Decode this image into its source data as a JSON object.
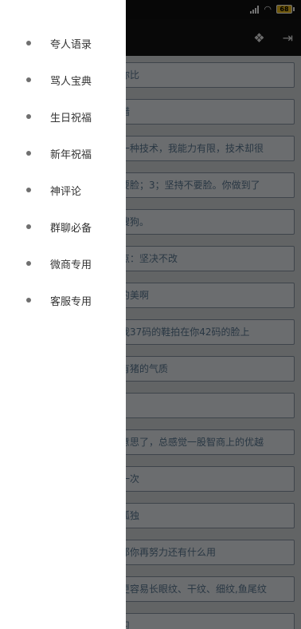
{
  "status_bar": {
    "battery_level": "68",
    "signal_icon": "signal-icon",
    "wifi_icon": "wifi-icon"
  },
  "app_bar": {
    "icons": [
      "dropbox-icon",
      "logout-icon"
    ]
  },
  "drawer": {
    "items": [
      {
        "label": "夸人语录"
      },
      {
        "label": "骂人宝典"
      },
      {
        "label": "生日祝福"
      },
      {
        "label": "新年祝福"
      },
      {
        "label": "神评论"
      },
      {
        "label": "群聊必备"
      },
      {
        "label": "微商专用"
      },
      {
        "label": "客服专用"
      }
    ]
  },
  "content_rows": [
    "你比",
    "错",
    "一种技术，我能力有限，技术却很",
    "要脸；3；坚持不要脸。你做到了",
    "搜狗。",
    "点：坚决不改",
    "的美啊",
    "我37码的鞋拍在你42码的脸上",
    "有猪的气质",
    "",
    "意思了，总感觉一股智商上的优越",
    "一次",
    "孤独",
    "那你再努力还有什么用",
    "更容易长眼纹、干纹、细纹,鱼尾纹",
    "习"
  ]
}
